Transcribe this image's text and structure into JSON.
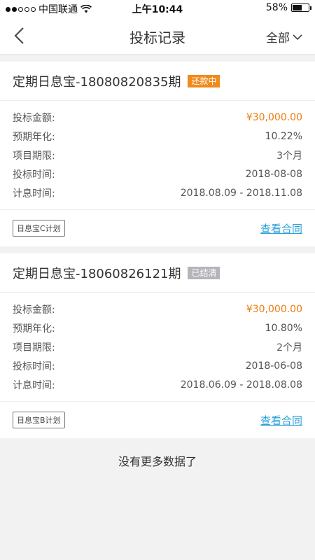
{
  "status_bar": {
    "carrier": "中国联通",
    "time": "上午10:44",
    "battery": "58%",
    "battery_level": 0.58
  },
  "nav": {
    "title": "投标记录",
    "filter_label": "全部"
  },
  "labels": {
    "amount": "投标金额:",
    "annual_rate": "预期年化:",
    "term": "项目期限:",
    "bid_time": "投标时间:",
    "interest_time": "计息时间:",
    "contract_link": "查看合同"
  },
  "records": [
    {
      "title": "定期日息宝-18080820835期",
      "status": "还款中",
      "status_color": "#f08a1c",
      "amount": "¥30,000.00",
      "annual_rate": "10.22%",
      "term": "3个月",
      "bid_time": "2018-08-08",
      "interest_time": "2018.08.09 - 2018.11.08",
      "plan": "日息宝C计划"
    },
    {
      "title": "定期日息宝-18060826121期",
      "status": "已结清",
      "status_color": "#b4b4bc",
      "amount": "¥30,000.00",
      "annual_rate": "10.80%",
      "term": "2个月",
      "bid_time": "2018-06-08",
      "interest_time": "2018.06.09 - 2018.08.08",
      "plan": "日息宝B计划"
    }
  ],
  "footer": {
    "no_more": "没有更多数据了"
  }
}
